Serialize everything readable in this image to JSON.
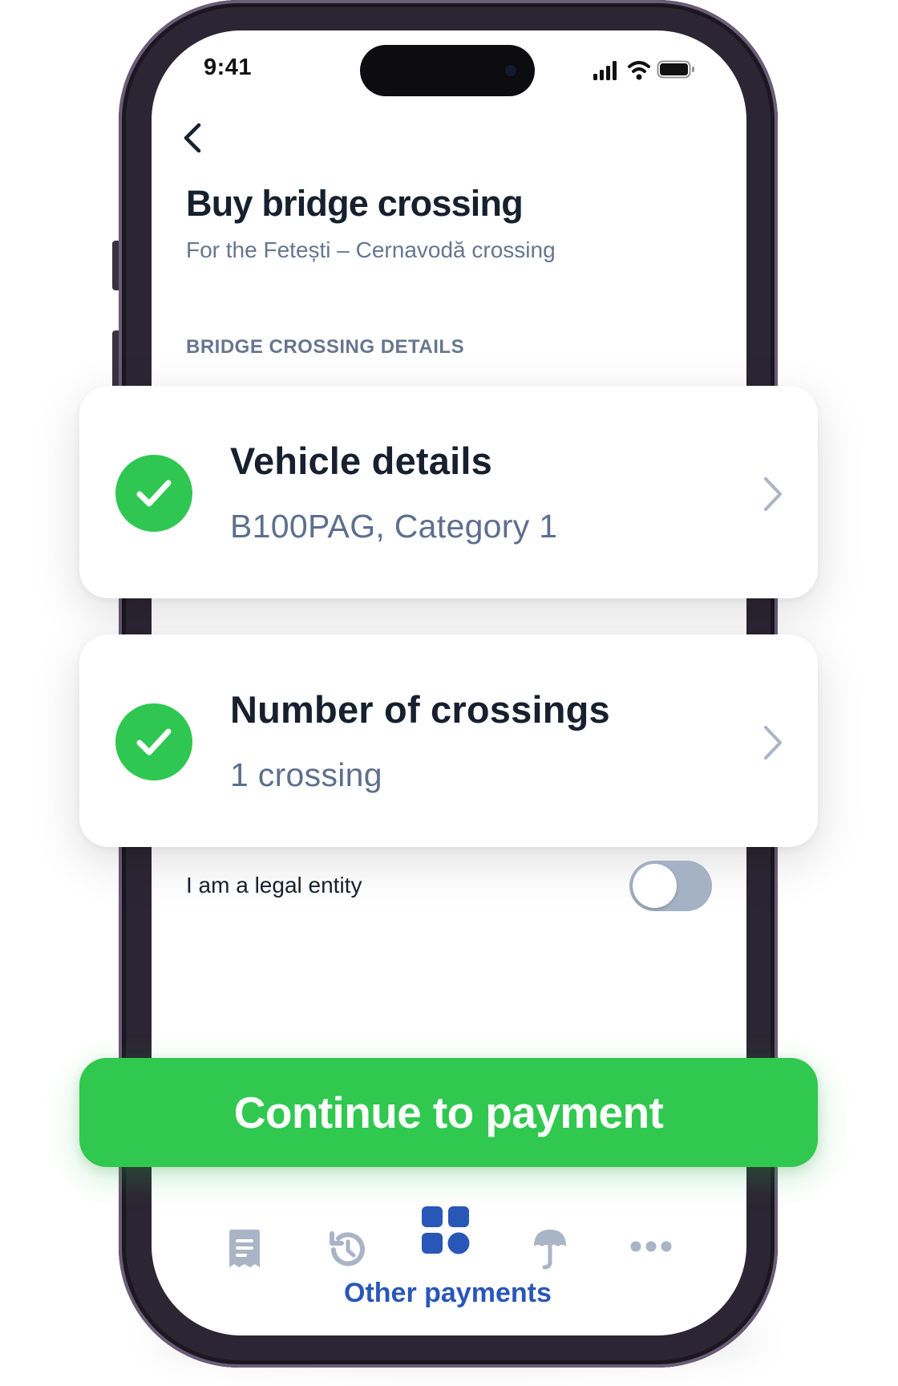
{
  "status_bar": {
    "time": "9:41",
    "icons": [
      "signal-icon",
      "wifi-icon",
      "battery-icon"
    ]
  },
  "header": {
    "back_icon": "chevron-left-icon",
    "title": "Buy bridge crossing",
    "subtitle": "For the Fetești – Cernavodă crossing"
  },
  "section": {
    "label": "BRIDGE CROSSING DETAILS"
  },
  "cards": [
    {
      "title": "Vehicle details",
      "value": "B100PAG, Category 1",
      "icon": "check-circle-icon",
      "status": "complete"
    },
    {
      "title": "Number of crossings",
      "value": "1 crossing",
      "icon": "check-circle-icon",
      "status": "complete"
    }
  ],
  "legal_entity": {
    "label": "I am a legal entity",
    "toggle_on": false
  },
  "primary_action": {
    "label": "Continue to payment"
  },
  "tab_bar": {
    "tabs": [
      {
        "icon": "receipt-icon",
        "active": false
      },
      {
        "icon": "history-icon",
        "active": false
      },
      {
        "icon": "grid-icon",
        "active": true,
        "label": "Other payments"
      },
      {
        "icon": "umbrella-icon",
        "active": false
      },
      {
        "icon": "more-icon",
        "active": false
      }
    ]
  },
  "colors": {
    "accent_green": "#30c84f",
    "active_blue": "#2957b8",
    "inactive_gray": "#a9b4c6",
    "title_text": "#17202e",
    "secondary_text": "#66768f"
  }
}
